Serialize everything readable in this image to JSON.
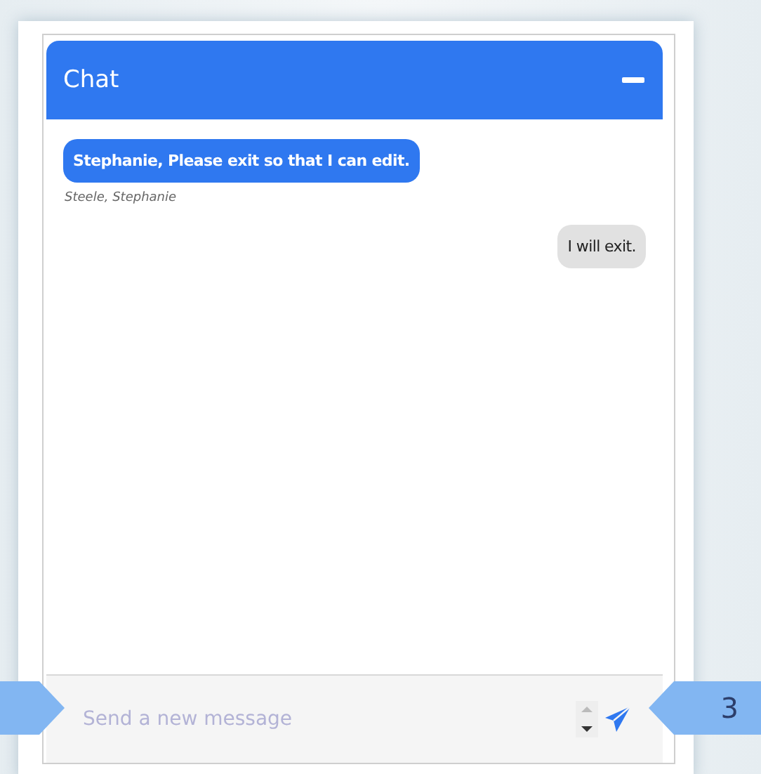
{
  "chat": {
    "title": "Chat",
    "messages": [
      {
        "kind": "incoming",
        "text": "Stephanie, Please exit so that I can edit.",
        "sender": "Steele, Stephanie"
      },
      {
        "kind": "outgoing",
        "text": "I will exit."
      }
    ],
    "composer": {
      "placeholder": "Send a new message"
    }
  },
  "callout": {
    "label": "3"
  }
}
